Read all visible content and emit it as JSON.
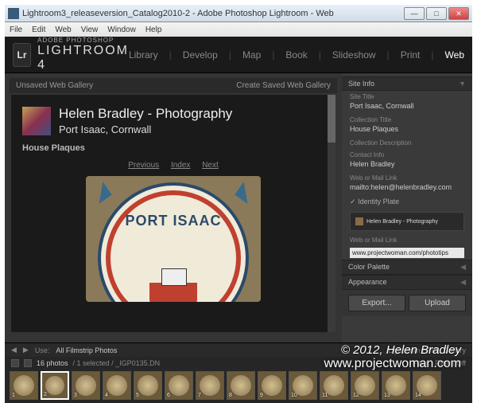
{
  "window": {
    "title": "Lightroom3_releaseversion_Catalog2010-2 - Adobe Photoshop Lightroom - Web"
  },
  "menu": [
    "File",
    "Edit",
    "Web",
    "View",
    "Window",
    "Help"
  ],
  "header": {
    "logo": "Lr",
    "brand1": "ADOBE PHOTOSHOP",
    "brand2": "LIGHTROOM 4"
  },
  "modules": [
    "Library",
    "Develop",
    "Map",
    "Book",
    "Slideshow",
    "Print",
    "Web"
  ],
  "preview": {
    "status": "Unsaved Web Gallery",
    "create": "Create Saved Web Gallery"
  },
  "gallery": {
    "title": "Helen Bradley - Photography",
    "subtitle": "Port Isaac, Cornwall",
    "collection": "House Plaques",
    "nav": [
      "Previous",
      "Index",
      "Next"
    ],
    "plate_text": "PORT ISAAC"
  },
  "panel": {
    "site_info": "Site Info",
    "labels": {
      "site_title": "Site Title",
      "collection_title": "Collection Title",
      "collection_desc": "Collection Description",
      "contact": "Contact Info",
      "webmail": "Web or Mail Link",
      "identity": "Identity Plate",
      "webmail2": "Web or Mail Link"
    },
    "values": {
      "site_title": "Port Isaac, Cornwall",
      "collection_title": "House Plaques",
      "contact": "Helen Bradley",
      "webmail": "mailto:helen@helenbradley.com",
      "identity": "Helen Bradley - Photography",
      "link_input": "www.projectwoman.com/phototips"
    },
    "color_palette": "Color Palette",
    "appearance": "Appearance"
  },
  "buttons": {
    "export": "Export...",
    "upload": "Upload"
  },
  "toolbar": {
    "use": "Use:",
    "use_val": "All Filmstrip Photos",
    "template": "Lightroom HTML Gallery"
  },
  "filmstrip": {
    "count": "16 photos",
    "sel": "/ 1 selected / _IGP0135.DN",
    "filter": "Filter:",
    "filters_off": "Filters Off"
  },
  "watermark": {
    "line1": "© 2012, Helen Bradley",
    "line2": "www.projectwoman.com"
  }
}
